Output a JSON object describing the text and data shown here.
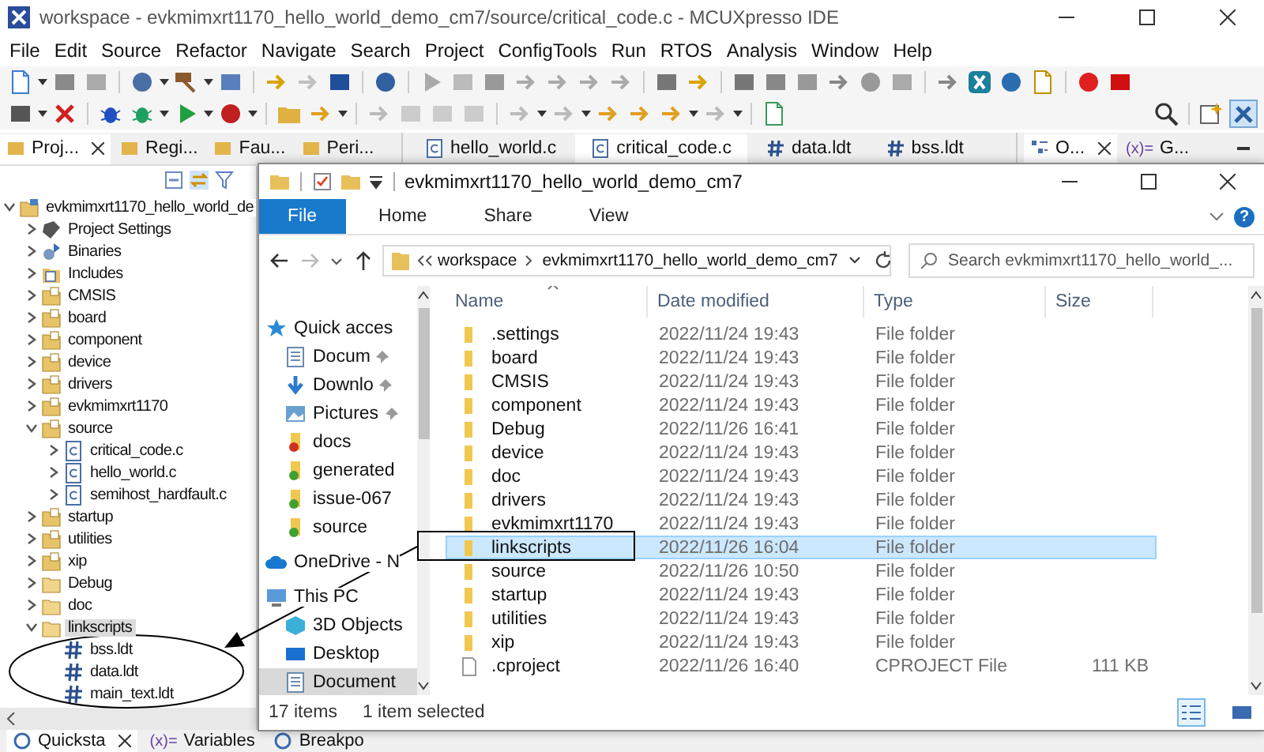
{
  "ide": {
    "title": "workspace - evkmimxrt1170_hello_world_demo_cm7/source/critical_code.c - MCUXpresso IDE",
    "menu": [
      "File",
      "Edit",
      "Source",
      "Refactor",
      "Navigate",
      "Search",
      "Project",
      "ConfigTools",
      "Run",
      "RTOS",
      "Analysis",
      "Window",
      "Help"
    ],
    "view_tabs": [
      {
        "label": "Proj...",
        "selected": true
      },
      {
        "label": "Regi...",
        "selected": false
      },
      {
        "label": "Fau...",
        "selected": false
      },
      {
        "label": "Peri...",
        "selected": false
      }
    ],
    "editor_tabs": [
      {
        "label": "hello_world.c",
        "kind": "c",
        "selected": false
      },
      {
        "label": "critical_code.c",
        "kind": "c",
        "selected": true
      },
      {
        "label": "data.ldt",
        "kind": "ldt",
        "selected": false
      },
      {
        "label": "bss.ldt",
        "kind": "ldt",
        "selected": false
      }
    ],
    "right_tabs": [
      {
        "label": "O...",
        "selected": true
      },
      {
        "label": "G...",
        "prefix": "(x)=",
        "selected": false
      }
    ],
    "tree": [
      {
        "label": "evkmimxrt1170_hello_world_de",
        "kind": "project",
        "expanded": true,
        "selected": false,
        "children": [
          {
            "label": "Project Settings",
            "kind": "settings",
            "expanded": false,
            "selected": false
          },
          {
            "label": "Binaries",
            "kind": "binaries",
            "expanded": false,
            "selected": false
          },
          {
            "label": "Includes",
            "kind": "includes",
            "expanded": false,
            "selected": false
          },
          {
            "label": "CMSIS",
            "kind": "srcfolder",
            "expanded": false,
            "selected": false
          },
          {
            "label": "board",
            "kind": "srcfolder",
            "expanded": false,
            "selected": false
          },
          {
            "label": "component",
            "kind": "srcfolder",
            "expanded": false,
            "selected": false
          },
          {
            "label": "device",
            "kind": "srcfolder",
            "expanded": false,
            "selected": false
          },
          {
            "label": "drivers",
            "kind": "srcfolder",
            "expanded": false,
            "selected": false
          },
          {
            "label": "evkmimxrt1170",
            "kind": "srcfolder",
            "expanded": false,
            "selected": false
          },
          {
            "label": "source",
            "kind": "srcfolder",
            "expanded": true,
            "selected": false,
            "children": [
              {
                "label": "critical_code.c",
                "kind": "cfile",
                "expanded": false,
                "selected": false
              },
              {
                "label": "hello_world.c",
                "kind": "cfile",
                "expanded": false,
                "selected": false
              },
              {
                "label": "semihost_hardfault.c",
                "kind": "cfile",
                "expanded": false,
                "selected": false
              }
            ]
          },
          {
            "label": "startup",
            "kind": "srcfolder",
            "expanded": false,
            "selected": false
          },
          {
            "label": "utilities",
            "kind": "srcfolder",
            "expanded": false,
            "selected": false
          },
          {
            "label": "xip",
            "kind": "srcfolder",
            "expanded": false,
            "selected": false
          },
          {
            "label": "Debug",
            "kind": "folder",
            "expanded": false,
            "selected": false
          },
          {
            "label": "doc",
            "kind": "folder",
            "expanded": false,
            "selected": false
          },
          {
            "label": "linkscripts",
            "kind": "folder",
            "expanded": true,
            "selected": true,
            "children": [
              {
                "label": "bss.ldt",
                "kind": "ldt",
                "selected": false
              },
              {
                "label": "data.ldt",
                "kind": "ldt",
                "selected": false
              },
              {
                "label": "main_text.ldt",
                "kind": "ldt",
                "selected": false
              }
            ]
          }
        ]
      }
    ],
    "bottom_tabs": [
      {
        "label": "Quicksta",
        "selected": true
      },
      {
        "label": "Variables",
        "prefix": "(x)=",
        "selected": false
      },
      {
        "label": "Breakpo",
        "selected": false
      }
    ]
  },
  "explorer": {
    "title": "evkmimxrt1170_hello_world_demo_cm7",
    "ribbon_tabs": [
      {
        "label": "File",
        "selected": true
      },
      {
        "label": "Home",
        "selected": false
      },
      {
        "label": "Share",
        "selected": false
      },
      {
        "label": "View",
        "selected": false
      }
    ],
    "help": "?",
    "path": [
      "workspace",
      "evkmimxrt1170_hello_world_demo_cm7"
    ],
    "search": {
      "placeholder": "Search evkmimxrt1170_hello_world_..."
    },
    "nav": [
      {
        "label": "Quick acces",
        "kind": "star",
        "pinned": false,
        "selected": false
      },
      {
        "label": "Docum",
        "kind": "doc",
        "pinned": true,
        "selected": false
      },
      {
        "label": "Downlo",
        "kind": "download",
        "pinned": true,
        "selected": false
      },
      {
        "label": "Pictures",
        "kind": "picture",
        "pinned": true,
        "selected": false
      },
      {
        "label": "docs",
        "kind": "redfolder",
        "pinned": false,
        "selected": false
      },
      {
        "label": "generated",
        "kind": "greenfolder",
        "pinned": false,
        "selected": false
      },
      {
        "label": "issue-067",
        "kind": "greenfolder",
        "pinned": false,
        "selected": false
      },
      {
        "label": "source",
        "kind": "greenfolder",
        "pinned": false,
        "selected": false
      },
      {
        "label": "OneDrive - N",
        "kind": "cloud",
        "pinned": false,
        "selected": false
      },
      {
        "label": "This PC",
        "kind": "pc",
        "pinned": false,
        "selected": false
      },
      {
        "label": "3D Objects",
        "kind": "cube",
        "pinned": false,
        "selected": false
      },
      {
        "label": "Desktop",
        "kind": "desktop",
        "pinned": false,
        "selected": false
      },
      {
        "label": "Document",
        "kind": "doc",
        "pinned": false,
        "selected": true
      }
    ],
    "columns": [
      "Name",
      "Date modified",
      "Type",
      "Size"
    ],
    "files": [
      {
        "name": ".settings",
        "date": "2022/11/24 19:43",
        "type": "File folder",
        "kind": "folder",
        "selected": false
      },
      {
        "name": "board",
        "date": "2022/11/24 19:43",
        "type": "File folder",
        "kind": "folder",
        "selected": false
      },
      {
        "name": "CMSIS",
        "date": "2022/11/24 19:43",
        "type": "File folder",
        "kind": "folder",
        "selected": false
      },
      {
        "name": "component",
        "date": "2022/11/24 19:43",
        "type": "File folder",
        "kind": "folder",
        "selected": false
      },
      {
        "name": "Debug",
        "date": "2022/11/26 16:41",
        "type": "File folder",
        "kind": "folder",
        "selected": false
      },
      {
        "name": "device",
        "date": "2022/11/24 19:43",
        "type": "File folder",
        "kind": "folder",
        "selected": false
      },
      {
        "name": "doc",
        "date": "2022/11/24 19:43",
        "type": "File folder",
        "kind": "folder",
        "selected": false
      },
      {
        "name": "drivers",
        "date": "2022/11/24 19:43",
        "type": "File folder",
        "kind": "folder",
        "selected": false
      },
      {
        "name": "evkmimxrt1170",
        "date": "2022/11/24 19:43",
        "type": "File folder",
        "kind": "folder",
        "selected": false
      },
      {
        "name": "linkscripts",
        "date": "2022/11/26 16:04",
        "type": "File folder",
        "kind": "folder",
        "selected": true
      },
      {
        "name": "source",
        "date": "2022/11/26 10:50",
        "type": "File folder",
        "kind": "folder",
        "selected": false
      },
      {
        "name": "startup",
        "date": "2022/11/24 19:43",
        "type": "File folder",
        "kind": "folder",
        "selected": false
      },
      {
        "name": "utilities",
        "date": "2022/11/24 19:43",
        "type": "File folder",
        "kind": "folder",
        "selected": false
      },
      {
        "name": "xip",
        "date": "2022/11/24 19:43",
        "type": "File folder",
        "kind": "folder",
        "selected": false
      },
      {
        "name": ".cproject",
        "date": "2022/11/26 16:40",
        "type": "CPROJECT File",
        "size": "111 KB",
        "kind": "file",
        "selected": false
      }
    ],
    "status": [
      "17 items",
      "1 item selected"
    ]
  }
}
